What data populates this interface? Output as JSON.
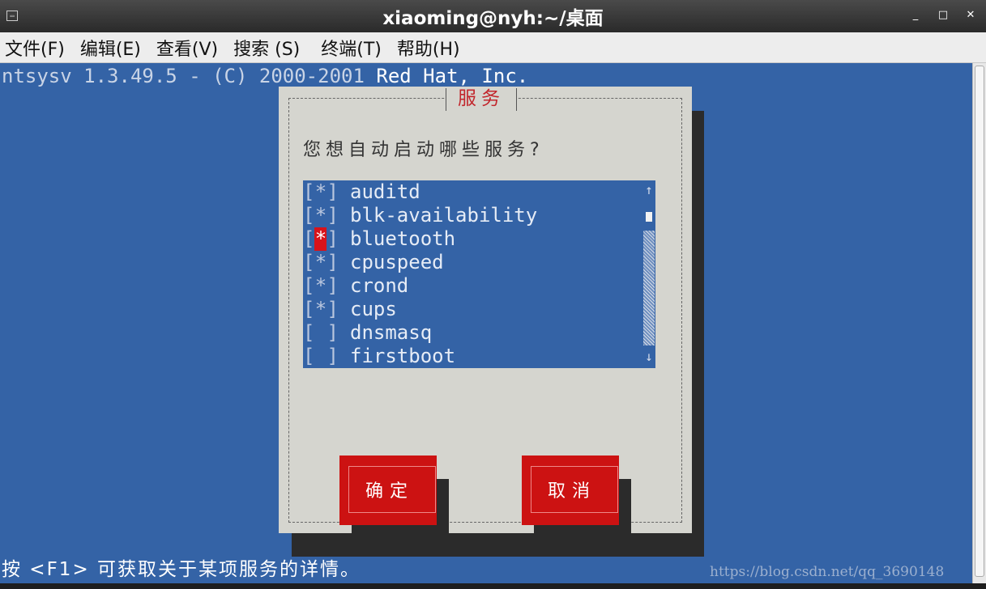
{
  "window": {
    "title": "xiaoming@nyh:~/桌面",
    "minimize": "_",
    "maximize": "□",
    "close": "✕"
  },
  "menu": [
    {
      "label": "文件(F)"
    },
    {
      "label": "编辑(E)"
    },
    {
      "label": "查看(V)"
    },
    {
      "label": "搜索 (S)"
    },
    {
      "label": "终端(T)"
    },
    {
      "label": "帮助(H)"
    }
  ],
  "terminal": {
    "header_prefix": "ntsysv 1.3.49.5 - (C) 2000-2001 ",
    "header_company": "Red Hat, Inc.",
    "footer": "按 <F1> 可获取关于某项服务的详情。",
    "watermark": "https://blog.csdn.net/qq_3690148"
  },
  "dialog": {
    "title": "服务",
    "question": "您想自动启动哪些服务?",
    "services": [
      {
        "name": "auditd",
        "mark": "*"
      },
      {
        "name": "blk-availability",
        "mark": "*"
      },
      {
        "name": "bluetooth",
        "mark": "*"
      },
      {
        "name": "cpuspeed",
        "mark": "*"
      },
      {
        "name": "crond",
        "mark": "*"
      },
      {
        "name": "cups",
        "mark": "*"
      },
      {
        "name": "dnsmasq",
        "mark": " "
      },
      {
        "name": "firstboot",
        "mark": " "
      }
    ],
    "focused_index": 2,
    "ok_label": "确定",
    "cancel_label": "取消",
    "scroll_up": "↑",
    "scroll_down": "↓"
  },
  "colors": {
    "terminal_bg": "#3463a6",
    "dialog_bg": "#d5d5cf",
    "accent_red": "#cc1212",
    "title_red": "#c2262c"
  }
}
